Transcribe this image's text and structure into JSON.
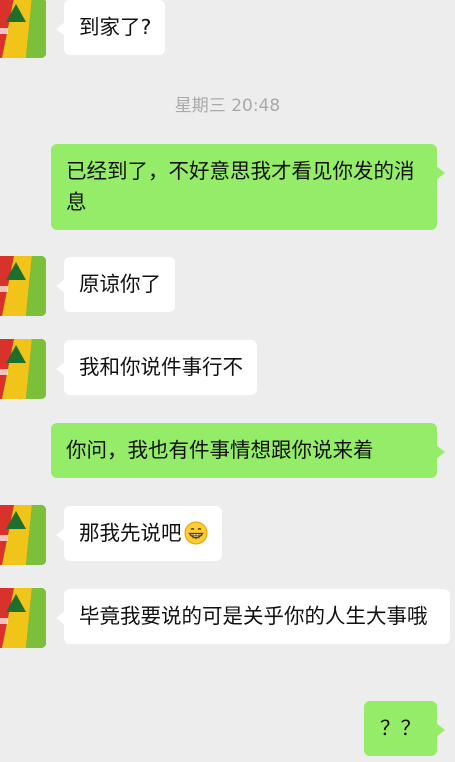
{
  "chat": {
    "timestamp": "星期三 20:48",
    "messages": [
      {
        "side": "in",
        "text": "到家了?"
      },
      {
        "side": "out",
        "text": "已经到了，不好意思我才看见你发的消息"
      },
      {
        "side": "in",
        "text": "原谅你了"
      },
      {
        "side": "in",
        "text": "我和你说件事行不"
      },
      {
        "side": "out",
        "text": "你问，我也有件事情想跟你说来着"
      },
      {
        "side": "in",
        "text": "那我先说吧",
        "emoji": "grinning-face-emoji"
      },
      {
        "side": "in",
        "text": "毕竟我要说的可是关乎你的人生大事哦"
      },
      {
        "side": "out",
        "text": "？？"
      }
    ]
  },
  "colors": {
    "background": "#ededed",
    "incoming_bubble": "#ffffff",
    "outgoing_bubble": "#95ec69",
    "timestamp_text": "#a9a9a9"
  },
  "icons": {
    "avatar": "contact-avatar-icon",
    "emoji": "grinning-face-emoji"
  }
}
